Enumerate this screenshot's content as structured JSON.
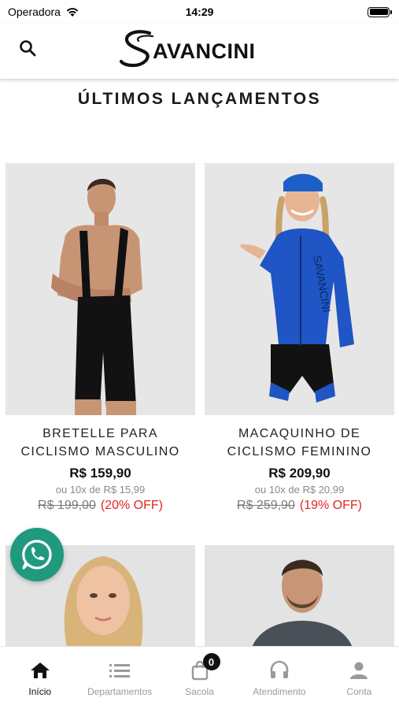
{
  "status_bar": {
    "carrier": "Operadora",
    "time": "14:29"
  },
  "header": {
    "logo_text": "Savancini"
  },
  "section": {
    "title": "ÚLTIMOS LANÇAMENTOS"
  },
  "products": [
    {
      "name": "BRETELLE PARA CICLISMO MASCULINO",
      "price": "R$ 159,90",
      "installments": "ou 10x de R$ 15,99",
      "old_price": "R$ 199,00",
      "discount": "(20% OFF)"
    },
    {
      "name": "MACAQUINHO DE CICLISMO FEMININO",
      "price": "R$ 209,90",
      "installments": "ou 10x de R$ 20,99",
      "old_price": "R$ 259,90",
      "discount": "(19% OFF)"
    }
  ],
  "tabbar": {
    "items": [
      {
        "label": "Início",
        "icon": "home-icon",
        "active": true
      },
      {
        "label": "Departamentos",
        "icon": "list-icon",
        "active": false
      },
      {
        "label": "Sacola",
        "icon": "bag-icon",
        "active": false,
        "badge": "0"
      },
      {
        "label": "Atendimento",
        "icon": "headset-icon",
        "active": false
      },
      {
        "label": "Conta",
        "icon": "user-icon",
        "active": false
      }
    ]
  },
  "colors": {
    "discount": "#e0261d",
    "whatsapp": "#1f9a7e",
    "text": "#222222",
    "muted": "#8a8a8a"
  }
}
